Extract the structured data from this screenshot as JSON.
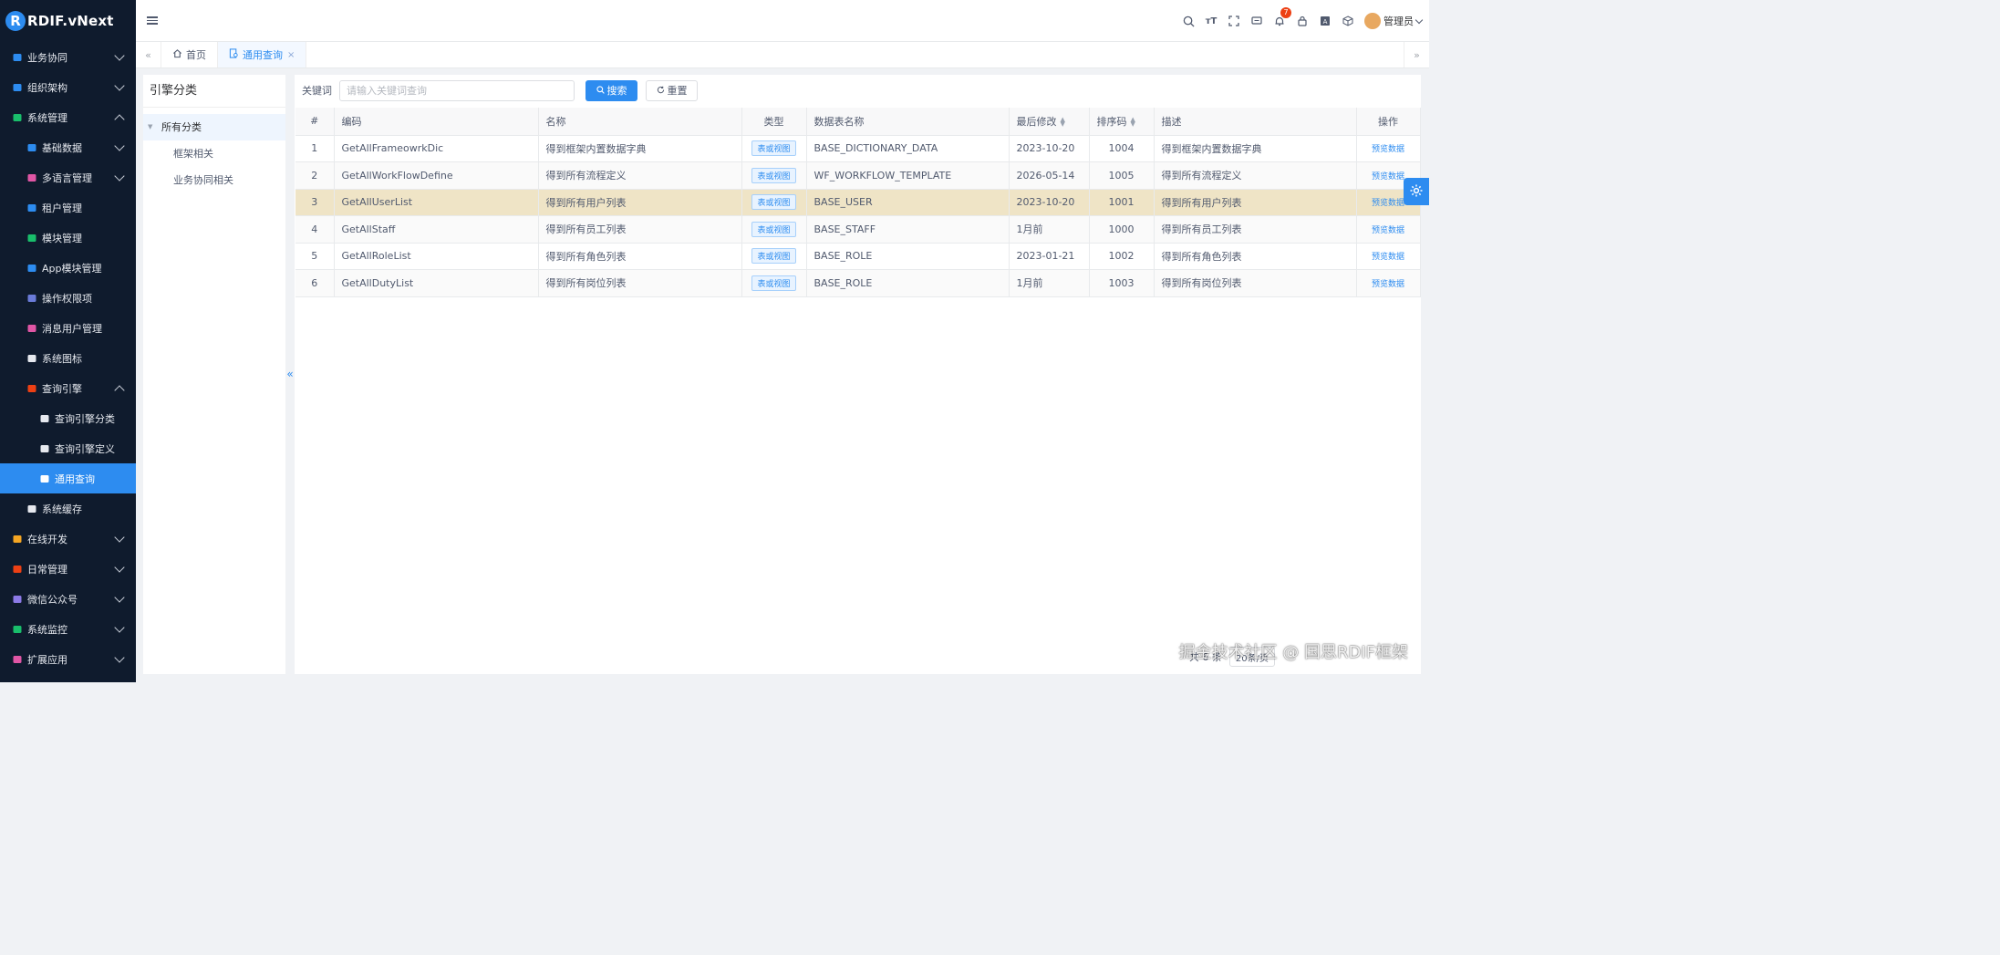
{
  "app": {
    "logo_letter": "R",
    "logo_text": "RDIF.vNext"
  },
  "sidebar": {
    "items": [
      {
        "label": "业务协同",
        "icon": "briefcase-icon",
        "color": "#2d8cf0",
        "level": 0,
        "chevron": "down"
      },
      {
        "label": "组织架构",
        "icon": "org-icon",
        "color": "#2d8cf0",
        "level": 0,
        "chevron": "down"
      },
      {
        "label": "系统管理",
        "icon": "gear-icon",
        "color": "#19be6b",
        "level": 0,
        "chevron": "up"
      },
      {
        "label": "基础数据",
        "icon": "database-icon",
        "color": "#2d8cf0",
        "level": 1,
        "chevron": "down"
      },
      {
        "label": "多语言管理",
        "icon": "globe-icon",
        "color": "#e056a5",
        "level": 1,
        "chevron": "down"
      },
      {
        "label": "租户管理",
        "icon": "tenant-icon",
        "color": "#2d8cf0",
        "level": 1,
        "chevron": ""
      },
      {
        "label": "模块管理",
        "icon": "grid-icon",
        "color": "#19be6b",
        "level": 1,
        "chevron": ""
      },
      {
        "label": "App模块管理",
        "icon": "app-grid-icon",
        "color": "#2d8cf0",
        "level": 1,
        "chevron": ""
      },
      {
        "label": "操作权限项",
        "icon": "permission-icon",
        "color": "#6a7bd8",
        "level": 1,
        "chevron": ""
      },
      {
        "label": "消息用户管理",
        "icon": "user-icon",
        "color": "#e056a5",
        "level": 1,
        "chevron": ""
      },
      {
        "label": "系统图标",
        "icon": "image-icon",
        "color": "#e6e9ef",
        "level": 1,
        "chevron": ""
      },
      {
        "label": "查询引擎",
        "icon": "filter-icon",
        "color": "#ed4014",
        "level": 1,
        "chevron": "up"
      },
      {
        "label": "查询引擎分类",
        "icon": "list-icon",
        "color": "#e6e9ef",
        "level": 2,
        "chevron": ""
      },
      {
        "label": "查询引擎定义",
        "icon": "flask-icon",
        "color": "#e6e9ef",
        "level": 2,
        "chevron": ""
      },
      {
        "label": "通用查询",
        "icon": "doc-search-icon",
        "color": "#ffffff",
        "level": 2,
        "chevron": "",
        "active": true
      },
      {
        "label": "系统缓存",
        "icon": "layers-icon",
        "color": "#e6e9ef",
        "level": 1,
        "chevron": ""
      },
      {
        "label": "在线开发",
        "icon": "dev-icon",
        "color": "#f5a623",
        "level": 0,
        "chevron": "down"
      },
      {
        "label": "日常管理",
        "icon": "calendar-icon",
        "color": "#ed4014",
        "level": 0,
        "chevron": "down"
      },
      {
        "label": "微信公众号",
        "icon": "wechat-icon",
        "color": "#8c7ae6",
        "level": 0,
        "chevron": "down"
      },
      {
        "label": "系统监控",
        "icon": "monitor-icon",
        "color": "#19be6b",
        "level": 0,
        "chevron": "down"
      },
      {
        "label": "扩展应用",
        "icon": "apps-icon",
        "color": "#e056a5",
        "level": 0,
        "chevron": "down"
      }
    ]
  },
  "topbar": {
    "icons": [
      "search-icon",
      "font-size-icon",
      "fullscreen-icon",
      "message-icon",
      "bell-icon",
      "lock-icon",
      "translate-icon",
      "cube-icon"
    ],
    "notification_count": "7",
    "user_name": "管理员"
  },
  "tabs": {
    "items": [
      {
        "label": "首页",
        "icon": "home-icon",
        "active": false,
        "closable": false
      },
      {
        "label": "通用查询",
        "icon": "doc-search-icon",
        "active": true,
        "closable": true
      }
    ]
  },
  "category_panel": {
    "title": "引擎分类",
    "root": "所有分类",
    "children": [
      "框架相关",
      "业务协同相关"
    ]
  },
  "search": {
    "label": "关键词",
    "placeholder": "请输入关键词查询",
    "search_label": "搜索",
    "reset_label": "重置"
  },
  "table": {
    "columns": [
      "#",
      "编码",
      "名称",
      "类型",
      "数据表名称",
      "最后修改",
      "排序码",
      "描述",
      "操作"
    ],
    "rows": [
      {
        "no": "1",
        "code": "GetAllFrameowrkDic",
        "name": "得到框架内置数据字典",
        "type": "表或视图",
        "table": "BASE_DICTIONARY_DATA",
        "modified": "2023-10-20",
        "sort": "1004",
        "desc": "得到框架内置数据字典",
        "op": "预览数据"
      },
      {
        "no": "2",
        "code": "GetAllWorkFlowDefine",
        "name": "得到所有流程定义",
        "type": "表或视图",
        "table": "WF_WORKFLOW_TEMPLATE",
        "modified": "2026-05-14",
        "sort": "1005",
        "desc": "得到所有流程定义",
        "op": "预览数据"
      },
      {
        "no": "3",
        "code": "GetAllUserList",
        "name": "得到所有用户列表",
        "type": "表或视图",
        "table": "BASE_USER",
        "modified": "2023-10-20",
        "sort": "1001",
        "desc": "得到所有用户列表",
        "op": "预览数据"
      },
      {
        "no": "4",
        "code": "GetAllStaff",
        "name": "得到所有员工列表",
        "type": "表或视图",
        "table": "BASE_STAFF",
        "modified": "1月前",
        "sort": "1000",
        "desc": "得到所有员工列表",
        "op": "预览数据"
      },
      {
        "no": "5",
        "code": "GetAllRoleList",
        "name": "得到所有角色列表",
        "type": "表或视图",
        "table": "BASE_ROLE",
        "modified": "2023-01-21",
        "sort": "1002",
        "desc": "得到所有角色列表",
        "op": "预览数据"
      },
      {
        "no": "6",
        "code": "GetAllDutyList",
        "name": "得到所有岗位列表",
        "type": "表或视图",
        "table": "BASE_ROLE",
        "modified": "1月前",
        "sort": "1003",
        "desc": "得到所有岗位列表",
        "op": "预览数据"
      }
    ],
    "highlight_row": 3
  },
  "pager": {
    "total": "共 6 条",
    "page_size": "20条/页"
  },
  "watermark": "掘金技术社区 @ 国思RDIF框架",
  "colors": {
    "primary": "#2d8cf0",
    "sidebar_bg": "#0f1b2d",
    "highlight_row": "#efe4c6"
  }
}
